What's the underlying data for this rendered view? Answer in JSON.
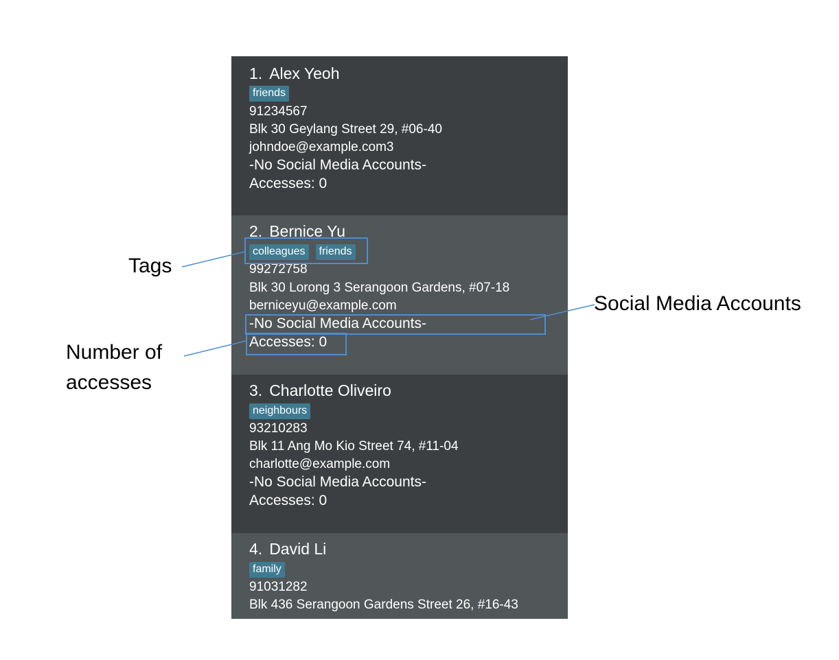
{
  "contacts": [
    {
      "index": "1.",
      "name": "Alex Yeoh",
      "tags": [
        "friends"
      ],
      "phone": "91234567",
      "address": "Blk 30 Geylang Street 29, #06-40",
      "email": "johndoe@example.com3",
      "social": "-No Social Media Accounts-",
      "accesses": "Accesses: 0"
    },
    {
      "index": "2.",
      "name": "Bernice Yu",
      "tags": [
        "colleagues",
        "friends"
      ],
      "phone": "99272758",
      "address": "Blk 30 Lorong 3 Serangoon Gardens, #07-18",
      "email": "berniceyu@example.com",
      "social": "-No Social Media Accounts-",
      "accesses": "Accesses: 0"
    },
    {
      "index": "3.",
      "name": "Charlotte Oliveiro",
      "tags": [
        "neighbours"
      ],
      "phone": "93210283",
      "address": "Blk 11 Ang Mo Kio Street 74, #11-04",
      "email": "charlotte@example.com",
      "social": "-No Social Media Accounts-",
      "accesses": "Accesses: 0"
    },
    {
      "index": "4.",
      "name": "David Li",
      "tags": [
        "family"
      ],
      "phone": "91031282",
      "address": "Blk 436 Serangoon Gardens Street 26, #16-43",
      "email": "",
      "social": "",
      "accesses": ""
    }
  ],
  "annotations": {
    "tags": "Tags",
    "social_media": "Social Media Accounts",
    "accesses_line1": "Number of",
    "accesses_line2": "accesses"
  },
  "colors": {
    "card_dark": "#3c3f41",
    "card_light": "#515658",
    "tag_bg": "#3e7b91",
    "highlight": "#4d8fd1"
  }
}
